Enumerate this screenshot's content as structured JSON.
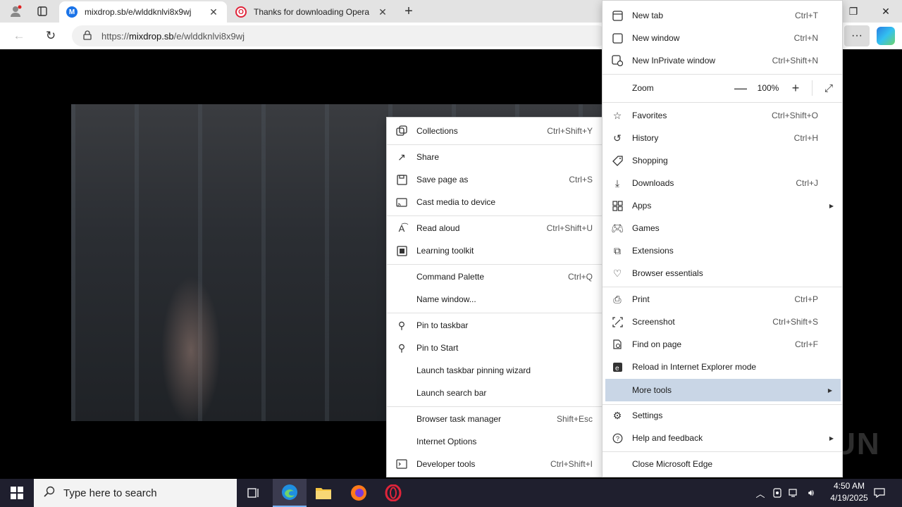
{
  "tabs": [
    {
      "title": "mixdrop.sb/e/wlddknlvi8x9wj",
      "favicon": "M",
      "active": true
    },
    {
      "title": "Thanks for downloading Opera",
      "favicon": "O",
      "active": false
    }
  ],
  "address": {
    "protocol": "https://",
    "host": "mixdrop.sb",
    "path": "/e/wlddknlvi8x9wj"
  },
  "main_menu": {
    "new_tab": {
      "label": "New tab",
      "shortcut": "Ctrl+T"
    },
    "new_window": {
      "label": "New window",
      "shortcut": "Ctrl+N"
    },
    "new_private": {
      "label": "New InPrivate window",
      "shortcut": "Ctrl+Shift+N"
    },
    "zoom": {
      "label": "Zoom",
      "value": "100%",
      "minus": "—",
      "plus": "+"
    },
    "favorites": {
      "label": "Favorites",
      "shortcut": "Ctrl+Shift+O"
    },
    "history": {
      "label": "History",
      "shortcut": "Ctrl+H"
    },
    "shopping": {
      "label": "Shopping"
    },
    "downloads": {
      "label": "Downloads",
      "shortcut": "Ctrl+J"
    },
    "apps": {
      "label": "Apps"
    },
    "games": {
      "label": "Games"
    },
    "extensions": {
      "label": "Extensions"
    },
    "essentials": {
      "label": "Browser essentials"
    },
    "print": {
      "label": "Print",
      "shortcut": "Ctrl+P"
    },
    "screenshot": {
      "label": "Screenshot",
      "shortcut": "Ctrl+Shift+S"
    },
    "find": {
      "label": "Find on page",
      "shortcut": "Ctrl+F"
    },
    "ie_mode": {
      "label": "Reload in Internet Explorer mode"
    },
    "more_tools": {
      "label": "More tools"
    },
    "settings": {
      "label": "Settings"
    },
    "help": {
      "label": "Help and feedback"
    },
    "close": {
      "label": "Close Microsoft Edge"
    }
  },
  "sub_menu": {
    "collections": {
      "label": "Collections",
      "shortcut": "Ctrl+Shift+Y"
    },
    "share": {
      "label": "Share"
    },
    "save_page": {
      "label": "Save page as",
      "shortcut": "Ctrl+S"
    },
    "cast": {
      "label": "Cast media to device"
    },
    "read_aloud": {
      "label": "Read aloud",
      "shortcut": "Ctrl+Shift+U"
    },
    "learning": {
      "label": "Learning toolkit"
    },
    "command_palette": {
      "label": "Command Palette",
      "shortcut": "Ctrl+Q"
    },
    "name_window": {
      "label": "Name window..."
    },
    "pin_taskbar": {
      "label": "Pin to taskbar"
    },
    "pin_start": {
      "label": "Pin to Start"
    },
    "pin_wizard": {
      "label": "Launch taskbar pinning wizard"
    },
    "search_bar": {
      "label": "Launch search bar"
    },
    "task_manager": {
      "label": "Browser task manager",
      "shortcut": "Shift+Esc"
    },
    "internet_options": {
      "label": "Internet Options"
    },
    "dev_tools": {
      "label": "Developer tools",
      "shortcut": "Ctrl+Shift+I"
    }
  },
  "watermark": "ANY RUN",
  "taskbar": {
    "search_placeholder": "Type here to search",
    "time": "4:50 AM",
    "date": "4/19/2025"
  },
  "colors": {
    "accent": "#0078d4",
    "menu_highlight": "#c9d6e6",
    "taskbar": "#1f1f2e"
  }
}
